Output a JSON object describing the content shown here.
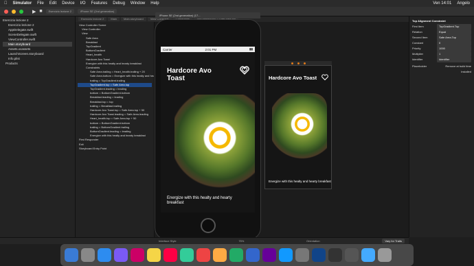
{
  "menubar": {
    "app": "Simulator",
    "items": [
      "File",
      "Edit",
      "Device",
      "I/O",
      "Features",
      "Debug",
      "Window",
      "Help"
    ],
    "clock": "Ven 14:01",
    "user": "Angelo"
  },
  "toolbar": {
    "scheme": "Esercizio lezione 2",
    "device": "iPhone SE (2nd generation)"
  },
  "sim_title": "iPhone SE (2nd generation) (17...",
  "tabs": [
    "Esercizio lezione 2",
    "Main",
    "Main.storyboard",
    "View Controller",
    "Constraints",
    "TopGradient.top = Safe Area.top"
  ],
  "navigator": {
    "items": [
      "Esercizio lezione 2",
      "Esercizio lezione 2",
      "AppDelegate.swift",
      "SceneDelegate.swift",
      "ViewController.swift",
      "Main.storyboard",
      "Assets.xcassets",
      "LaunchScreen.storyboard",
      "Info.plist",
      "Products"
    ],
    "selected": 5
  },
  "outline": {
    "items": [
      "View Controller Scene",
      "View Controller",
      "View",
      "Safe Area",
      "Breakfast",
      "TopGradient",
      "BottomGradient",
      "Heart_health",
      "Hardcore Avo Toast",
      "Energize with this healty and hearty breakfast",
      "Constraints",
      "Safe Area.trailing = Heart_health.trailing + 20",
      "Safe Area.bottom = Energize with this healty and hearty breakfast",
      "trailing = TopGradient.trailing",
      "TopGradient.top = Safe Area.top",
      "TopGradient.leading = leading",
      "bottom = BottomGradient.bottom",
      "Breakfast.leading = leading",
      "Breakfast.top = top",
      "trailing = Breakfast.trailing",
      "Hardcore Avo Toast.top = Safe Area.top + 50",
      "Hardcore Avo Toast.leading = Safe Area.leading",
      "Heart_health.top = Safe Area.top + 50",
      "bottom = BottomGradient.bottom",
      "trailing = BottomGradient.trailing",
      "BottomGradient.leading = leading",
      "Energize with this healty and hearty breakfast",
      "First Responder",
      "Exit",
      "Storyboard Entry Point"
    ],
    "selected": 14
  },
  "phone": {
    "carrier": "Carrier",
    "time": "2:01 PM",
    "title": "Hardcore Avo Toast",
    "subtitle": "Energize with this healty and hearty breakfast"
  },
  "inspector": {
    "heading": "Top Alignment Constraint",
    "rows": [
      {
        "label": "First Item",
        "value": "TopGradient.Top"
      },
      {
        "label": "Relation",
        "value": "Equal"
      },
      {
        "label": "Second Item",
        "value": "Safe Area.Top"
      },
      {
        "label": "Constant",
        "value": "0"
      },
      {
        "label": "Priority",
        "value": "1000"
      },
      {
        "label": "Multiplier",
        "value": "1"
      },
      {
        "label": "Identifier",
        "value": "Identifier"
      }
    ],
    "placeholder": "Remove at build time",
    "installed": "Installed"
  },
  "bottombar": {
    "zoom": "75%",
    "vary": "Vary for Traits",
    "interface": "Interface Style",
    "orientation": "Orientation"
  },
  "colors": {
    "accent": "#1e4a8a",
    "egg": "#f5b800",
    "avocado": "#8ea33a"
  }
}
